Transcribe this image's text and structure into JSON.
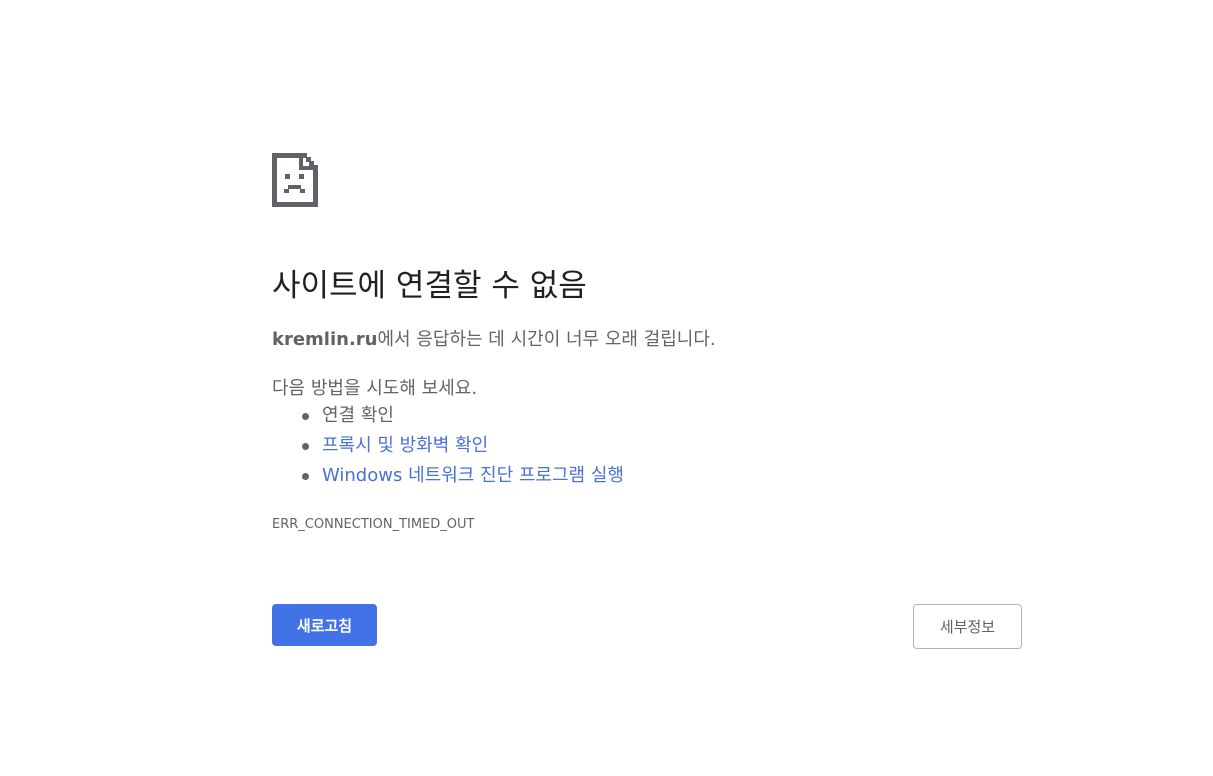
{
  "error": {
    "icon": "sad-page-icon",
    "title": "사이트에 연결할 수 없음",
    "host": "kremlin.ru",
    "summary_suffix": "에서 응답하는 데 시간이 너무 오래 걸립니다.",
    "suggestions_heading": "다음 방법을 시도해 보세요.",
    "suggestions": [
      {
        "label": "연결 확인",
        "is_link": false
      },
      {
        "label": "프록시 및 방화벽 확인",
        "is_link": true
      },
      {
        "label": "Windows 네트워크 진단 프로그램 실행",
        "is_link": true
      }
    ],
    "code": "ERR_CONNECTION_TIMED_OUT"
  },
  "buttons": {
    "reload_label": "새로고침",
    "details_label": "세부정보"
  },
  "colors": {
    "primary_button": "#4273e6",
    "link": "#4872d6",
    "title_text": "#202124",
    "body_text": "#646464"
  }
}
